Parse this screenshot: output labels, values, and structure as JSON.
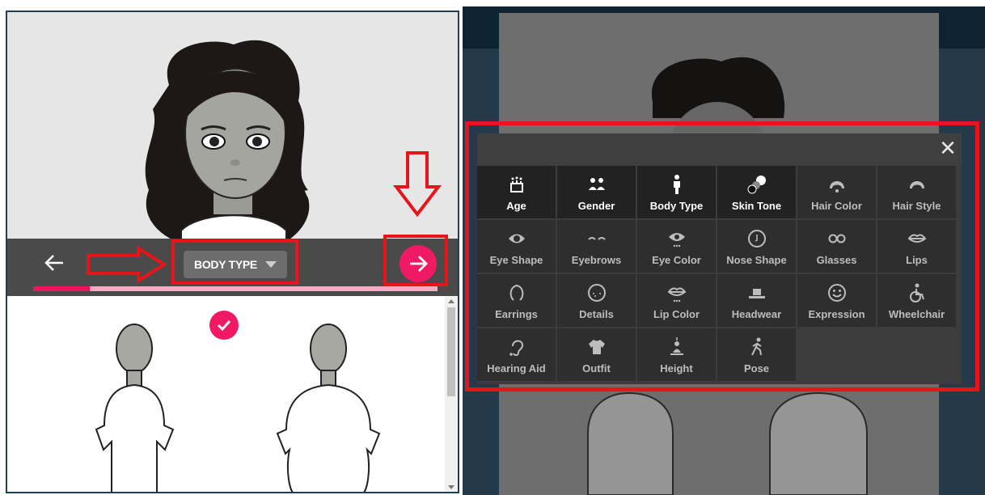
{
  "left": {
    "toolbar": {
      "category_label": "BODY TYPE"
    },
    "progress_fraction": 0.14
  },
  "right": {
    "modal": {
      "close_glyph": "✕",
      "items": [
        {
          "label": "Age",
          "icon": "cake-icon",
          "active": true
        },
        {
          "label": "Gender",
          "icon": "people-icon",
          "active": true
        },
        {
          "label": "Body Type",
          "icon": "person-icon",
          "active": true
        },
        {
          "label": "Skin Tone",
          "icon": "skin-tone-icon",
          "active": true
        },
        {
          "label": "Hair Color",
          "icon": "hair-color-icon",
          "active": false
        },
        {
          "label": "Hair Style",
          "icon": "hair-style-icon",
          "active": false
        },
        {
          "label": "Eye Shape",
          "icon": "eye-shape-icon",
          "active": false
        },
        {
          "label": "Eyebrows",
          "icon": "eyebrows-icon",
          "active": false
        },
        {
          "label": "Eye Color",
          "icon": "eye-color-icon",
          "active": false
        },
        {
          "label": "Nose Shape",
          "icon": "nose-icon",
          "active": false
        },
        {
          "label": "Glasses",
          "icon": "glasses-icon",
          "active": false
        },
        {
          "label": "Lips",
          "icon": "lips-icon",
          "active": false
        },
        {
          "label": "Earrings",
          "icon": "earring-icon",
          "active": false
        },
        {
          "label": "Details",
          "icon": "details-icon",
          "active": false
        },
        {
          "label": "Lip Color",
          "icon": "lip-color-icon",
          "active": false
        },
        {
          "label": "Headwear",
          "icon": "hat-icon",
          "active": false
        },
        {
          "label": "Expression",
          "icon": "smiley-icon",
          "active": false
        },
        {
          "label": "Wheelchair",
          "icon": "wheelchair-icon",
          "active": false
        },
        {
          "label": "Hearing Aid",
          "icon": "ear-icon",
          "active": false
        },
        {
          "label": "Outfit",
          "icon": "shirt-icon",
          "active": false
        },
        {
          "label": "Height",
          "icon": "height-icon",
          "active": false
        },
        {
          "label": "Pose",
          "icon": "walking-icon",
          "active": false
        }
      ]
    }
  },
  "colors": {
    "accent": "#ef1a63",
    "annotation_red": "#e8141a",
    "toolbar": "#4a4a4a"
  }
}
